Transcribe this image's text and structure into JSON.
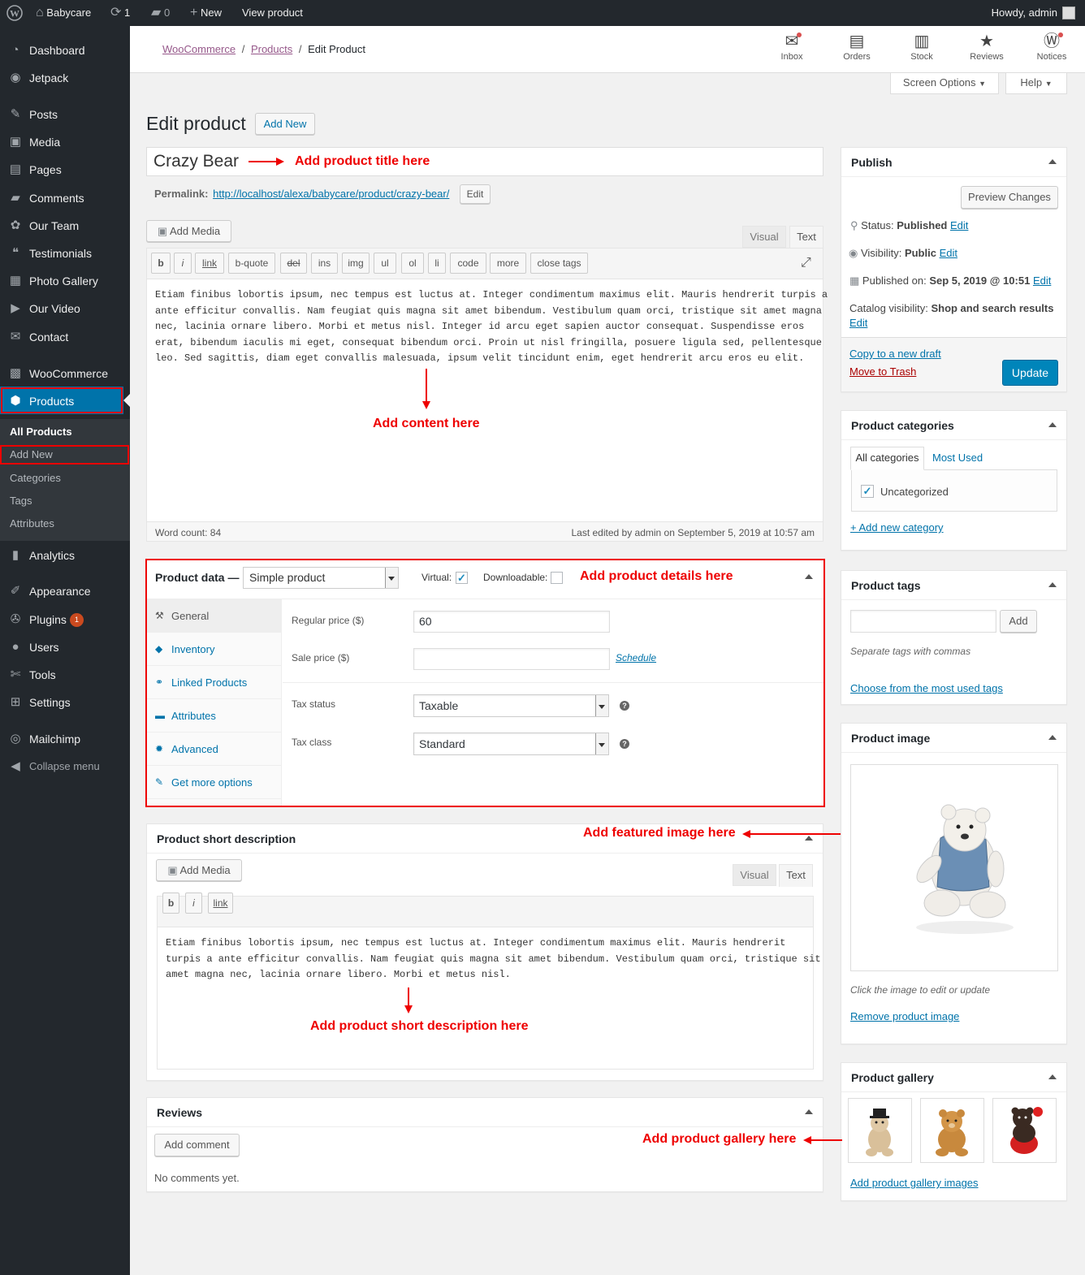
{
  "admin_bar": {
    "site_name": "Babycare",
    "updates_count": "1",
    "comments_count": "0",
    "new_label": "New",
    "view_product_label": "View product",
    "howdy": "Howdy, admin"
  },
  "sidebar": {
    "items": [
      {
        "label": "Dashboard",
        "icon": "dashboard-icon"
      },
      {
        "label": "Jetpack",
        "icon": "jetpack-icon"
      },
      {
        "label": "Posts",
        "icon": "pin-icon"
      },
      {
        "label": "Media",
        "icon": "media-icon"
      },
      {
        "label": "Pages",
        "icon": "pages-icon"
      },
      {
        "label": "Comments",
        "icon": "comments-icon"
      },
      {
        "label": "Our Team",
        "icon": "groups-icon"
      },
      {
        "label": "Testimonials",
        "icon": "quote-icon"
      },
      {
        "label": "Photo Gallery",
        "icon": "gallery-icon"
      },
      {
        "label": "Our Video",
        "icon": "video-icon"
      },
      {
        "label": "Contact",
        "icon": "email-icon"
      },
      {
        "label": "WooCommerce",
        "icon": "woo-icon"
      },
      {
        "label": "Products",
        "icon": "products-icon"
      },
      {
        "label": "Analytics",
        "icon": "analytics-icon"
      },
      {
        "label": "Appearance",
        "icon": "brush-icon"
      },
      {
        "label": "Plugins",
        "icon": "plugin-icon"
      },
      {
        "label": "Users",
        "icon": "users-icon"
      },
      {
        "label": "Tools",
        "icon": "tools-icon"
      },
      {
        "label": "Settings",
        "icon": "settings-icon"
      },
      {
        "label": "Mailchimp",
        "icon": "mailchimp-icon"
      },
      {
        "label": "Collapse menu",
        "icon": "collapse-icon"
      }
    ],
    "plugins_badge": "1",
    "submenu": [
      "All Products",
      "Add New",
      "Categories",
      "Tags",
      "Attributes"
    ]
  },
  "breadcrumb": {
    "woocommerce": "WooCommerce",
    "products": "Products",
    "sep": "/",
    "current": "Edit Product"
  },
  "activity": [
    {
      "label": "Inbox",
      "icon": "inbox-icon"
    },
    {
      "label": "Orders",
      "icon": "orders-icon"
    },
    {
      "label": "Stock",
      "icon": "stock-icon"
    },
    {
      "label": "Reviews",
      "icon": "star-icon"
    },
    {
      "label": "Notices",
      "icon": "wordpress-icon"
    }
  ],
  "screen_options": "Screen Options",
  "help": "Help",
  "page": {
    "title": "Edit product",
    "add_new": "Add New"
  },
  "product": {
    "title": "Crazy Bear",
    "permalink_label": "Permalink:",
    "permalink_url": "http://localhost/alexa/babycare/product/crazy-bear/",
    "permalink_edit": "Edit"
  },
  "editor": {
    "add_media": "Add Media",
    "tab_visual": "Visual",
    "tab_text": "Text",
    "quicktags": [
      "b",
      "i",
      "link",
      "b-quote",
      "del",
      "ins",
      "img",
      "ul",
      "ol",
      "li",
      "code",
      "more",
      "close tags"
    ],
    "content_lines": [
      "Etiam finibus lobortis ipsum, nec tempus est luctus at. Integer condimentum maximus elit. Mauris hendrerit turpis a",
      "ante efficitur convallis. Nam feugiat quis magna sit amet bibendum. Vestibulum quam orci, tristique sit amet magna",
      "nec, lacinia ornare libero. Morbi et metus nisl. Integer id arcu eget sapien auctor consequat. Suspendisse eros",
      "erat, bibendum iaculis mi eget, consequat bibendum orci. Proin ut nisl fringilla, posuere ligula sed, pellentesque",
      "leo. Sed sagittis, diam eget convallis malesuada, ipsum velit tincidunt enim, eget hendrerit arcu eros eu elit."
    ],
    "word_count": "Word count: 84",
    "last_edited": "Last edited by admin on September 5, 2019 at 10:57 am"
  },
  "annotations": {
    "title": "Add product title here",
    "content": "Add content here",
    "details": "Add product details here",
    "featured": "Add featured image here",
    "short_desc": "Add product short description here",
    "gallery": "Add product gallery here"
  },
  "product_data": {
    "label": "Product data —",
    "type": "Simple product",
    "virtual_label": "Virtual:",
    "virtual_checked": true,
    "downloadable_label": "Downloadable:",
    "downloadable_checked": false,
    "tabs": [
      {
        "label": "General",
        "icon": "wrench-icon"
      },
      {
        "label": "Inventory",
        "icon": "tag-icon"
      },
      {
        "label": "Linked Products",
        "icon": "link-icon"
      },
      {
        "label": "Attributes",
        "icon": "list-icon"
      },
      {
        "label": "Advanced",
        "icon": "gear-icon"
      },
      {
        "label": "Get more options",
        "icon": "plugins-icon"
      }
    ],
    "regular_price_label": "Regular price ($)",
    "regular_price": "60",
    "sale_price_label": "Sale price ($)",
    "sale_price": "",
    "schedule": "Schedule",
    "tax_status_label": "Tax status",
    "tax_status": "Taxable",
    "tax_class_label": "Tax class",
    "tax_class": "Standard"
  },
  "short_description": {
    "title": "Product short description",
    "add_media": "Add Media",
    "tab_visual": "Visual",
    "tab_text": "Text",
    "quicktags": [
      "b",
      "i",
      "link"
    ],
    "lines": [
      "Etiam finibus lobortis ipsum, nec tempus est luctus at. Integer condimentum maximus elit. Mauris hendrerit",
      "turpis a ante efficitur convallis. Nam feugiat quis magna sit amet bibendum. Vestibulum quam orci, tristique sit",
      "amet magna nec, lacinia ornare libero. Morbi et metus nisl."
    ]
  },
  "reviews": {
    "title": "Reviews",
    "add_comment": "Add comment",
    "empty": "No comments yet."
  },
  "publish": {
    "title": "Publish",
    "preview": "Preview Changes",
    "status_label": "Status:",
    "status": "Published",
    "visibility_label": "Visibility:",
    "visibility": "Public",
    "published_label": "Published on:",
    "published": "Sep 5, 2019 @ 10:51",
    "catalog_label": "Catalog visibility:",
    "catalog": "Shop and search results",
    "edit": "Edit",
    "copy_draft": "Copy to a new draft",
    "trash": "Move to Trash",
    "update": "Update"
  },
  "categories": {
    "title": "Product categories",
    "tab_all": "All categories",
    "tab_most": "Most Used",
    "items": [
      {
        "label": "Uncategorized",
        "checked": true
      }
    ],
    "add_new": "+ Add new category"
  },
  "tags": {
    "title": "Product tags",
    "add": "Add",
    "hint": "Separate tags with commas",
    "choose": "Choose from the most used tags"
  },
  "product_image": {
    "title": "Product image",
    "hint": "Click the image to edit or update",
    "remove": "Remove product image"
  },
  "gallery": {
    "title": "Product gallery",
    "add": "Add product gallery images"
  },
  "colors": {
    "accent": "#0073aa",
    "sidebar_bg": "#23282d",
    "active_menu": "#0073aa",
    "annotation": "#ee0000"
  }
}
